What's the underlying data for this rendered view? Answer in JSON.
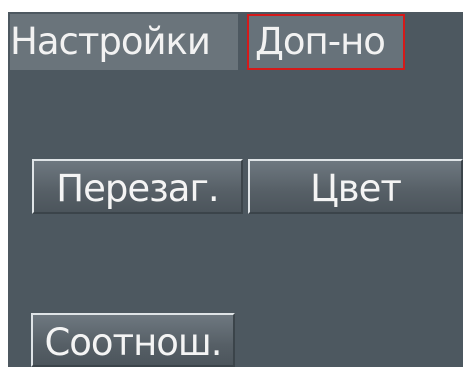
{
  "tabs": {
    "settings_label": "Настройки",
    "extra_label": "Доп-но"
  },
  "buttons": {
    "restart_label": "Перезаг.",
    "color_label": "Цвет",
    "ratio_label": "Соотнош."
  },
  "colors": {
    "background": "#4d5860",
    "active_tab_border": "#d51a1a",
    "text": "#f2f2f2"
  }
}
